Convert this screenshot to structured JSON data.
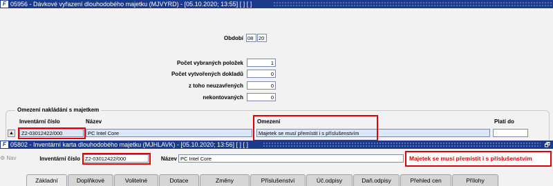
{
  "window1": {
    "title": "05956 - Dávkové vyřazení dlouhodobého majetku (MJVYRD) - [05.10.2020; 13:55] [ ] [ ]",
    "obdobi": {
      "label": "Období",
      "month": "08",
      "year": "20"
    },
    "counts": [
      {
        "label": "Počet vybraných položek",
        "value": "1"
      },
      {
        "label": "Počet vytvořených dokladů",
        "value": "0"
      },
      {
        "label": "z toho  neuzavřených",
        "value": "0"
      },
      {
        "label": "nekontovaných",
        "value": "0"
      }
    ],
    "group_title": "Omezení nakládání s majetkem",
    "columns": {
      "inv": "Inventární číslo",
      "nazev": "Název",
      "omezeni": "Omezení",
      "plati": "Platí do"
    },
    "row": {
      "inv": "Z2-03012422/000",
      "nazev": "PC Intel Core",
      "omezeni": "Majetek se musí přemístit i s příslušenstvím",
      "plati": ""
    }
  },
  "window2": {
    "title": "05802 - Inventární karta dlouhodobého majetku (MJHLAVK) - [05.10.2020; 13:56] [ ] [ ]",
    "nav_label": "Nav",
    "inv_label": "Inventární číslo",
    "inv_value": "Z2-03012422/000",
    "nazev_label": "Název",
    "nazev_value": "PC Intel Core",
    "warning": "Majetek se musí přemístit i s příslušenstvím",
    "tabs": [
      "Základní",
      "Doplňkové",
      "Volitelné",
      "Dotace",
      "Změny",
      "Příslušenství",
      "Úč.odpisy",
      "Daň.odpisy",
      "Přehled cen",
      "Přílohy"
    ]
  },
  "colors": {
    "titlebar": "#1b3a8c",
    "highlight": "#e00000"
  }
}
